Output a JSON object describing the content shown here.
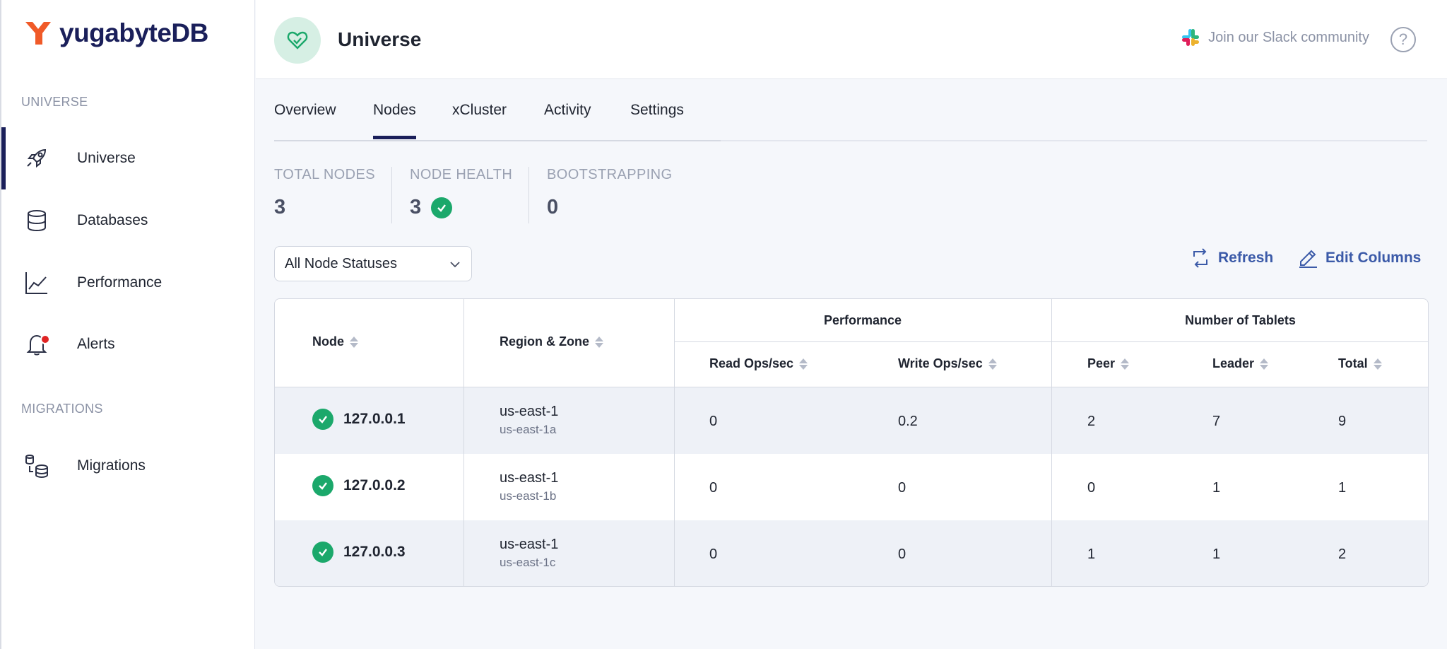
{
  "app": {
    "logo_text": "yugabyteDB",
    "brand_color": "#f05a28",
    "nav_color": "#1a1f5a"
  },
  "sidebar": {
    "sections": [
      {
        "label": "UNIVERSE"
      },
      {
        "label": "MIGRATIONS"
      }
    ],
    "items": [
      {
        "label": "Universe",
        "icon": "rocket-icon",
        "active": true
      },
      {
        "label": "Databases",
        "icon": "database-icon"
      },
      {
        "label": "Performance",
        "icon": "line-chart-icon"
      },
      {
        "label": "Alerts",
        "icon": "bell-icon",
        "has_alert": true
      },
      {
        "label": "Migrations",
        "icon": "migrations-icon"
      }
    ]
  },
  "header": {
    "title": "Universe",
    "slack_link": "Join our Slack community",
    "help_label": "?"
  },
  "tabs": [
    {
      "label": "Overview"
    },
    {
      "label": "Nodes",
      "active": true
    },
    {
      "label": "xCluster"
    },
    {
      "label": "Activity"
    },
    {
      "label": "Settings"
    }
  ],
  "stats": {
    "total_nodes": {
      "label": "TOTAL NODES",
      "value": "3"
    },
    "node_health": {
      "label": "NODE HEALTH",
      "value": "3",
      "status": "healthy"
    },
    "bootstrapping": {
      "label": "BOOTSTRAPPING",
      "value": "0"
    }
  },
  "controls": {
    "status_filter": "All Node Statuses",
    "refresh_label": "Refresh",
    "edit_columns_label": "Edit Columns"
  },
  "table": {
    "headers": {
      "node": "Node",
      "region_zone": "Region & Zone",
      "performance_group": "Performance",
      "tablets_group": "Number of Tablets",
      "read_ops": "Read Ops/sec",
      "write_ops": "Write Ops/sec",
      "peer": "Peer",
      "leader": "Leader",
      "total": "Total"
    },
    "rows": [
      {
        "node": "127.0.0.1",
        "region": "us-east-1",
        "zone": "us-east-1a",
        "read_ops": "0",
        "write_ops": "0.2",
        "peer": "2",
        "leader": "7",
        "total": "9"
      },
      {
        "node": "127.0.0.2",
        "region": "us-east-1",
        "zone": "us-east-1b",
        "read_ops": "0",
        "write_ops": "0",
        "peer": "0",
        "leader": "1",
        "total": "1"
      },
      {
        "node": "127.0.0.3",
        "region": "us-east-1",
        "zone": "us-east-1c",
        "read_ops": "0",
        "write_ops": "0",
        "peer": "1",
        "leader": "1",
        "total": "2"
      }
    ]
  }
}
